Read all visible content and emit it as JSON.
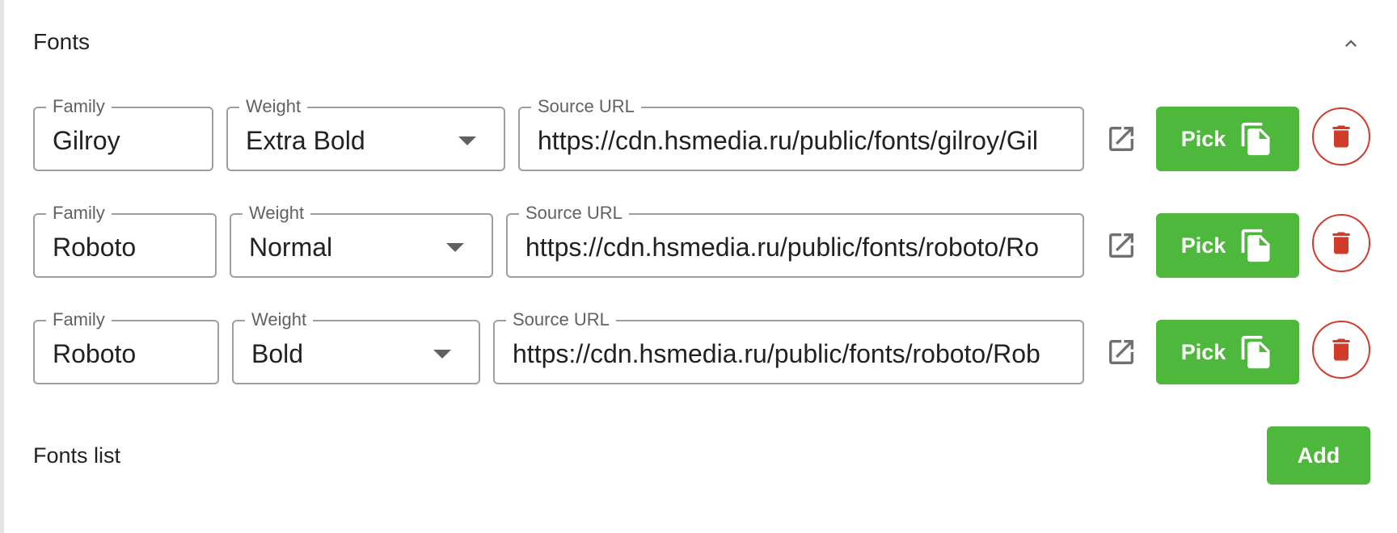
{
  "colors": {
    "accent_green": "#4db83c",
    "danger_red": "#d13b2a",
    "outline_gray": "#9e9e9e",
    "icon_gray": "#707070"
  },
  "panel": {
    "title": "Fonts",
    "collapse_icon": "chevron-up-icon"
  },
  "labels": {
    "family": "Family",
    "weight": "Weight",
    "source_url": "Source URL",
    "pick": "Pick"
  },
  "icons": {
    "open": "open-in-new-icon",
    "pick": "file-copy-icon",
    "delete": "trash-icon",
    "select": "caret-down-icon"
  },
  "fonts": [
    {
      "family": "Gilroy",
      "weight": "Extra Bold",
      "source_url": "https://cdn.hsmedia.ru/public/fonts/gilroy/Gil"
    },
    {
      "family": "Roboto",
      "weight": "Normal",
      "source_url": "https://cdn.hsmedia.ru/public/fonts/roboto/Ro"
    },
    {
      "family": "Roboto",
      "weight": "Bold",
      "source_url": "https://cdn.hsmedia.ru/public/fonts/roboto/Rob"
    }
  ],
  "footer": {
    "label": "Fonts list",
    "add_label": "Add"
  }
}
